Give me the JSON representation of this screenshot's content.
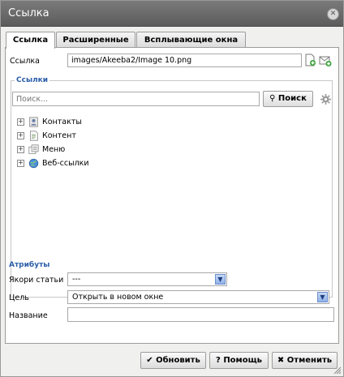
{
  "dialog": {
    "title": "Ссылка",
    "close_icon": "close-icon"
  },
  "tabs": [
    {
      "label": "Ссылка",
      "active": true
    },
    {
      "label": "Расширенные",
      "active": false
    },
    {
      "label": "Всплывающие окна",
      "active": false
    }
  ],
  "link": {
    "label": "Ссылка",
    "value": "images/Akeeba2/Image 10.png",
    "icons": [
      "browse-file-icon",
      "email-link-icon"
    ]
  },
  "links_section": {
    "legend": "Ссылки",
    "search_placeholder": "Поиск...",
    "search_button": "Поиск",
    "settings_icon": "gear-icon",
    "tree": [
      {
        "label": "Контакты",
        "icon": "contacts-icon"
      },
      {
        "label": "Контент",
        "icon": "content-icon"
      },
      {
        "label": "Меню",
        "icon": "menu-icon"
      },
      {
        "label": "Веб-ссылки",
        "icon": "weblinks-icon"
      }
    ]
  },
  "attributes": {
    "legend": "Атрибуты",
    "anchors": {
      "label": "Якори статьи",
      "value": "---"
    },
    "target": {
      "label": "Цель",
      "value": "Открыть в новом окне"
    },
    "name": {
      "label": "Название",
      "value": ""
    }
  },
  "footer": {
    "update": "Обновить",
    "help": "Помощь",
    "cancel": "Отменить"
  },
  "colors": {
    "accent": "#2b5ea8",
    "titlebar": "#666666"
  }
}
